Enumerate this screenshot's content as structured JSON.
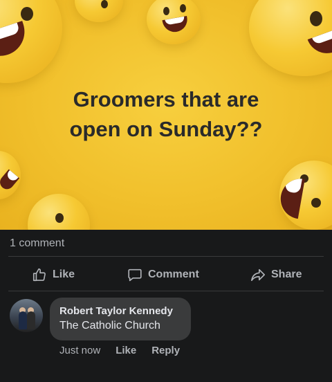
{
  "post": {
    "text_line1": "Groomers that are",
    "text_line2": "open on Sunday??",
    "background_color": "#f1c02c"
  },
  "stats": {
    "comment_count": "1 comment"
  },
  "actions": {
    "like_label": "Like",
    "comment_label": "Comment",
    "share_label": "Share",
    "like_icon": "thumbs-up-icon",
    "comment_icon": "speech-bubble-icon",
    "share_icon": "share-arrow-icon"
  },
  "comment": {
    "author": "Robert Taylor Kennedy",
    "text": "The Catholic Church",
    "time": "Just now",
    "like_label": "Like",
    "reply_label": "Reply"
  },
  "colors": {
    "footer_bg": "#18191a",
    "bubble_bg": "#3a3b3c",
    "muted_text": "#b0b3b8",
    "primary_text": "#e4e6eb"
  }
}
